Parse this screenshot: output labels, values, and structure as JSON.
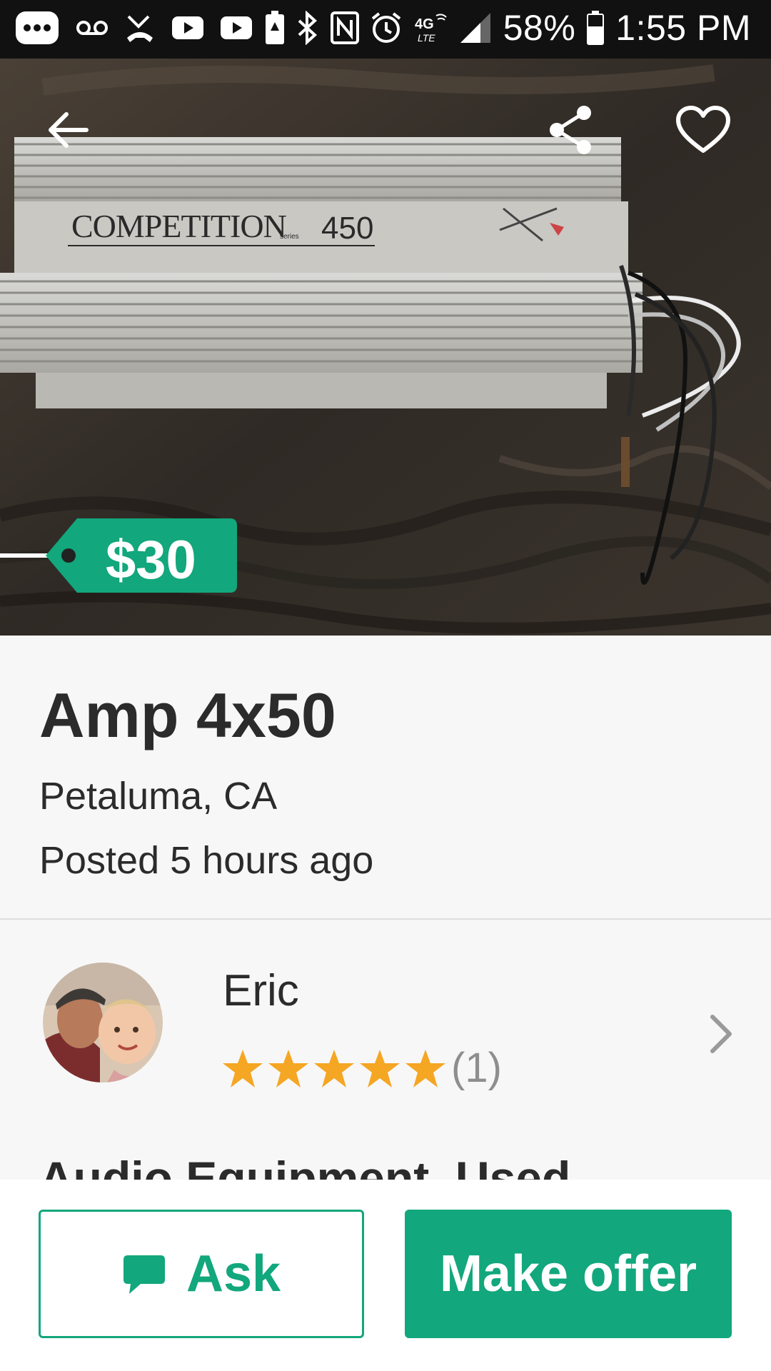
{
  "status_bar": {
    "battery": "58%",
    "time": "1:55 PM",
    "network": "4G LTE",
    "icons": [
      "more-icon",
      "voicemail-icon",
      "missed-call-icon",
      "youtube-icon",
      "youtube-icon",
      "battery-saver-icon",
      "bluetooth-icon",
      "nfc-icon",
      "alarm-icon",
      "network-icon",
      "signal-icon",
      "battery-icon"
    ]
  },
  "hero": {
    "photo_text": "COMPETITION",
    "photo_model": "450",
    "photo_series": "series",
    "price": "$30",
    "icons": {
      "back": "arrow-left-icon",
      "share": "share-icon",
      "favorite": "heart-outline-icon"
    }
  },
  "listing": {
    "title": "Amp 4x50",
    "location": "Petaluma, CA",
    "posted": "Posted 5 hours ago",
    "category": "Audio Equipment, Used"
  },
  "seller": {
    "name": "Eric",
    "rating": 5,
    "rating_max": 5,
    "rating_count": "(1)"
  },
  "actions": {
    "ask_label": "Ask",
    "offer_label": "Make offer"
  },
  "colors": {
    "accent": "#12a77c",
    "star": "#f5a623",
    "text": "#2b2b2b",
    "muted": "#8e8e8e"
  }
}
